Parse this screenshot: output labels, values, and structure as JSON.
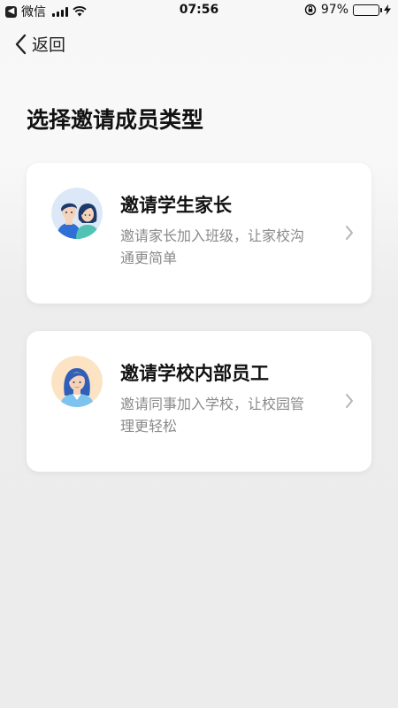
{
  "status_bar": {
    "back_app_label": "微信",
    "time": "07:56",
    "battery_percent": "97%",
    "battery_level": 0.97
  },
  "nav": {
    "back_label": "返回"
  },
  "page": {
    "title": "选择邀请成员类型"
  },
  "options": [
    {
      "title": "邀请学生家长",
      "description": "邀请家长加入班级，让家校沟通更简单",
      "avatar": "parents-avatar-icon"
    },
    {
      "title": "邀请学校内部员工",
      "description": "邀请同事加入学校，让校园管理更轻松",
      "avatar": "staff-avatar-icon"
    }
  ],
  "colors": {
    "accent_blue": "#2f6fd6",
    "card_bg": "#ffffff",
    "muted_text": "#8a8a8a"
  }
}
